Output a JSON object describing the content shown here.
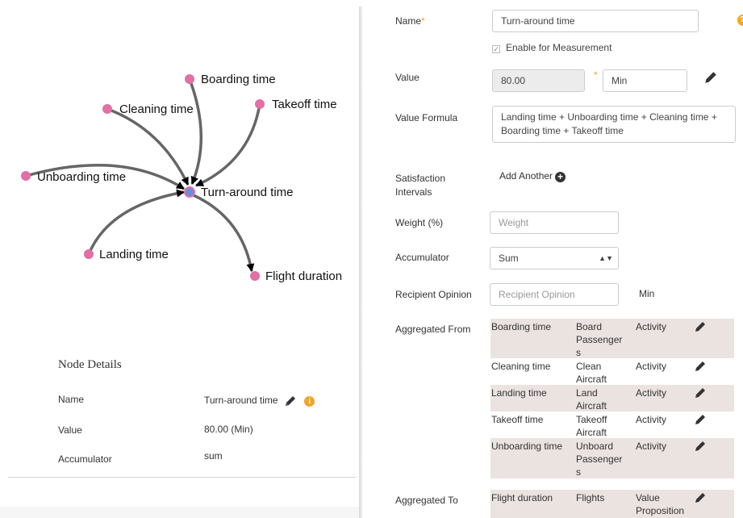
{
  "graph": {
    "nodes": [
      {
        "key": "boarding",
        "label": "Boarding time"
      },
      {
        "key": "cleaning",
        "label": "Cleaning time"
      },
      {
        "key": "takeoff",
        "label": "Takeoff time"
      },
      {
        "key": "unboarding",
        "label": "Unboarding time"
      },
      {
        "key": "center",
        "label": "Turn-around time"
      },
      {
        "key": "landing",
        "label": "Landing time"
      },
      {
        "key": "flight",
        "label": "Flight duration"
      }
    ],
    "colors": {
      "node": "#e26fa6",
      "center_node": "#6a8fd8",
      "edge": "#666666",
      "arrow": "#000000"
    }
  },
  "node_details": {
    "title": "Node Details",
    "name_label": "Name",
    "name_value": "Turn-around time",
    "value_label": "Value",
    "value_value": "80.00 (Min)",
    "accumulator_label": "Accumulator",
    "accumulator_value": "sum"
  },
  "form": {
    "name_label": "Name",
    "required_mark": "*",
    "name_value": "Turn-around time",
    "enable_measurement": "Enable for Measurement",
    "value_label": "Value",
    "value_value": "80.00",
    "unit_value": "Min",
    "formula_label": "Value Formula",
    "formula_value": "Landing time + Unboarding time + Cleaning time + Boarding time + Takeoff time",
    "satisfaction_label_1": "Satisfaction",
    "satisfaction_label_2": "Intervals",
    "add_another": "Add Another",
    "weight_label": "Weight (%)",
    "weight_placeholder": "Weight",
    "accumulator_label": "Accumulator",
    "accumulator_value": "Sum",
    "recipient_label": "Recipient Opinion",
    "recipient_placeholder": "Recipient Opinion",
    "recipient_unit": "Min",
    "aggregated_from_label": "Aggregated From",
    "aggregated_from": [
      {
        "name": "Boarding time",
        "activity": "Board Passenger s",
        "type": "Activity"
      },
      {
        "name": "Cleaning time",
        "activity": "Clean Aircraft",
        "type": "Activity"
      },
      {
        "name": "Landing time",
        "activity": "Land Aircraft",
        "type": "Activity"
      },
      {
        "name": "Takeoff time",
        "activity": "Takeoff Aircraft",
        "type": "Activity"
      },
      {
        "name": "Unboarding time",
        "activity": "Unboard Passenger s",
        "type": "Activity"
      }
    ],
    "aggregated_to_label": "Aggregated To",
    "aggregated_to": [
      {
        "name": "Flight duration",
        "activity": "Flights",
        "type": "Value Proposition"
      }
    ]
  }
}
